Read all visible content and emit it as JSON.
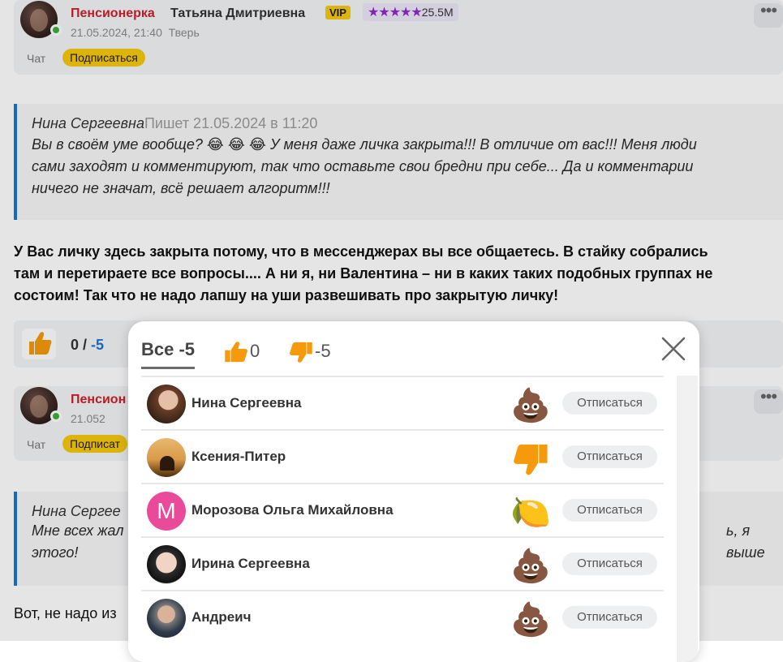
{
  "feed": {
    "post1": {
      "role": "Пенсионерка",
      "name": "Татьяна Дмитриевна",
      "vip": "VIP",
      "stars": "★★★★★",
      "rating": "25.5M",
      "datetime": "21.05.2024, 21:40",
      "city": "Тверь",
      "chat_label": "Чат",
      "subscribe_label": "Подписаться",
      "more": "•••"
    },
    "quote1": {
      "author": "Нина Сергеевна",
      "when": "Пишет 21.05.2024 в 11:20",
      "line1": "Вы в своём уме вообще? 😂 😂 😂 У меня даже личка закрыта!!! В отличие от вас!!! Меня люди",
      "line2": "сами заходят и комментируют, так что оставьте свои бредни при себе... Да и комментарии",
      "line3": "ничего не значат, всё решает алгоритм!!!"
    },
    "reply1": {
      "line1": "У Вас личку здесь закрыта потому, что в мессенджерах вы все общаетесь. В стайку собрались",
      "line2": "там и перетираете все вопросы.... А ни я, ни Валентина – ни в каких таких подобных группах не",
      "line3": "состоим! Так что не надо лапшу на уши развешивать про закрытую личку!"
    },
    "votes": {
      "score": "0 /",
      "negative": "-5"
    },
    "post2": {
      "role": "Пенсион",
      "datetime": "21.052",
      "chat_label": "Чат",
      "subscribe_label": "Подписат",
      "more": "•••"
    },
    "quote2": {
      "author": "Нина Сергее",
      "line1": "Мне всех жал",
      "line1_right": "ь, я выше",
      "line2": "этого!"
    },
    "reply2": {
      "text": "Вот, не надо из"
    }
  },
  "modal": {
    "tabs": [
      {
        "label": "Все -5"
      },
      {
        "label": "0"
      },
      {
        "label": "-5"
      }
    ],
    "close_icon": "close-icon",
    "unsubscribe_label": "Отписаться",
    "users": [
      {
        "name": "Нина Сергеевна",
        "reaction": "poop-emoji",
        "reaction_glyph": "💩",
        "avatar_letter": ""
      },
      {
        "name": "Ксения-Питер",
        "reaction": "thumbs-down-icon",
        "reaction_glyph": "",
        "avatar_letter": ""
      },
      {
        "name": "Морозова Ольга Михайловна",
        "reaction": "lemon-emoji",
        "reaction_glyph": "🍋",
        "avatar_letter": "М"
      },
      {
        "name": "Ирина Сергеевна",
        "reaction": "poop-emoji",
        "reaction_glyph": "💩",
        "avatar_letter": ""
      },
      {
        "name": "Андреич",
        "reaction": "poop-emoji",
        "reaction_glyph": "💩",
        "avatar_letter": ""
      }
    ]
  },
  "colors": {
    "accent_yellow": "#f6c90e",
    "thumb_orange": "#f59a0c",
    "role_red": "#d0202b",
    "quote_border": "#1976d2",
    "stars_purple": "#8e2bc9"
  }
}
